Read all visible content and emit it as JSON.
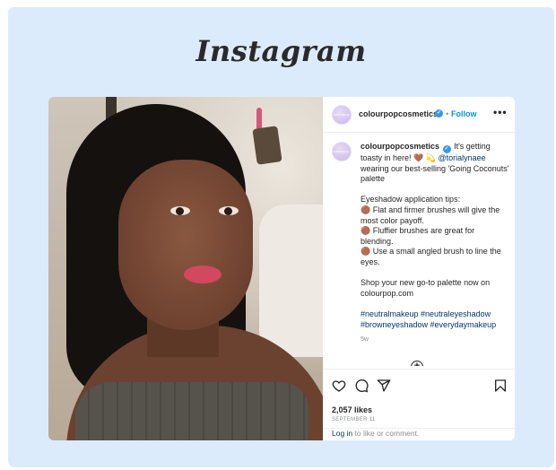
{
  "brand": {
    "title": "Instagram"
  },
  "post": {
    "username": "colourpopcosmetics",
    "follow_label": "Follow",
    "separator": "•",
    "more_label": "•••",
    "avatar_text": "colourpop",
    "caption": {
      "username": "colourpopcosmetics",
      "line1": "It's getting toasty in here! 🤎 💫",
      "mention": "@torialynaee",
      "line1_rest": "wearing our best-selling 'Going Coconuts' palette",
      "tips_header": "Eyeshadow application tips:",
      "tips": [
        "🟤 Flat and firmer brushes will give the most color payoff.",
        "🟤 Fluffier brushes are great for blending.",
        "🟤 Use a small angled brush to line the eyes."
      ],
      "cta": "Shop your new go-to palette now on colourpop.com",
      "hashtags": "#neutralmakeup #neutraleyeshadow #browneyeshadow #everydaymakeup",
      "time_ago": "5w"
    },
    "add_comment_icon": "plus-circle-icon",
    "actions": {
      "like_icon": "heart-icon",
      "comment_icon": "comment-icon",
      "share_icon": "share-icon",
      "save_icon": "bookmark-icon"
    },
    "likes": "2,057 likes",
    "date": "SEPTEMBER 11",
    "login": {
      "link": "Log in",
      "text": "to like or comment."
    }
  },
  "colors": {
    "background": "#dcebfb",
    "link": "#0095f6",
    "hashtag": "#00376b"
  }
}
